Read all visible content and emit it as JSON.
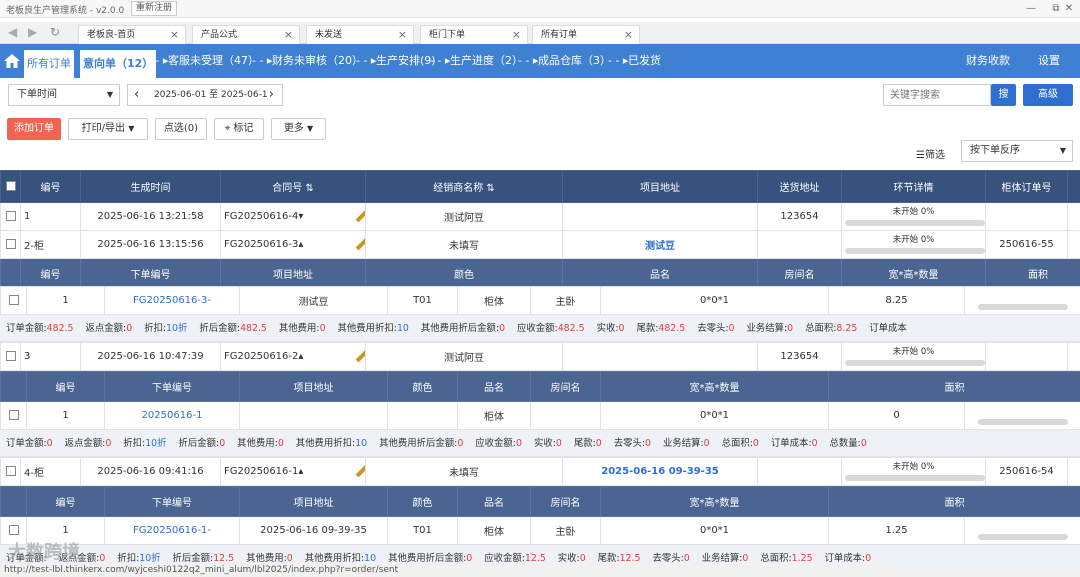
{
  "window": {
    "title": "老板良生产管理系统 - v2.0.0",
    "reregister": "重新注册",
    "min": "—",
    "restore": "⧉",
    "close": "✕"
  },
  "browser_tabs": [
    {
      "label": "老板良-首页"
    },
    {
      "label": "产品公式"
    },
    {
      "label": "未发送"
    },
    {
      "label": "柜门下单"
    },
    {
      "label": "所有订单"
    }
  ],
  "nav": {
    "home_icon": "home-icon",
    "all_orders": "所有订单",
    "intent": "意向单（12）",
    "s1": "客服未受理（47）",
    "s2": "财务未审核（20）",
    "s3": "生产安排(9)",
    "s4": "生产进度（2）",
    "s5": "成品仓库（3）",
    "s6": "已发货",
    "arrow": "- - ▸",
    "finance": "财务收款",
    "settings": "设置"
  },
  "filter": {
    "time_select": "下单时间",
    "date_range": "2025-06-01 至 2025-06-1",
    "prev": "‹",
    "next": "›",
    "search_placeholder": "关键字搜索",
    "search_btn": "搜",
    "advanced": "高级"
  },
  "toolbar": {
    "add": "添加订单",
    "print": "打印/导出",
    "select": "点选(0)",
    "mark": "标记",
    "more": "更多",
    "filter": "筛选",
    "sort": "按下单反序"
  },
  "columns": [
    "编号",
    "生成时间",
    "合同号",
    "经销商名称",
    "项目地址",
    "送货地址",
    "环节详情",
    "柜体订单号"
  ],
  "sub_columns": [
    "编号",
    "下单编号",
    "项目地址",
    "颜色",
    "品名",
    "房间名",
    "宽*高*数量",
    "面积"
  ],
  "progress_label": "未开始 0%",
  "orders": [
    {
      "no": "1",
      "time": "2025-06-16 13:21:58",
      "contract": "FG20250616-4",
      "caret": "▾",
      "dealer": "测试阿豆",
      "addr": "",
      "delivery": "123654",
      "cab": ""
    },
    {
      "no": "2-柜",
      "time": "2025-06-16 13:15:56",
      "contract": "FG20250616-3",
      "caret": "▴",
      "dealer": "未填写",
      "addr": "测试豆",
      "delivery": "",
      "cab": "250616-55",
      "sub": {
        "no": "1",
        "code": "FG20250616-3-",
        "addr": "测试豆",
        "color": "T01",
        "name": "柜体",
        "room": "主卧",
        "dims": "0*0*1",
        "area": "8.25"
      },
      "summary": [
        "订单金额:",
        "482.5",
        "返点金额:",
        "0",
        "折扣:",
        "10折",
        "折后金额:",
        "482.5",
        "其他费用:",
        "0",
        "其他费用折扣:",
        "10",
        "其他费用折后金额:",
        "0",
        "应收金额:",
        "482.5",
        "实收:",
        "0",
        "尾款:",
        "482.5",
        "去零头:",
        "0",
        "业务结算:",
        "0",
        "总面积:",
        "8.25",
        "订单成本",
        ""
      ]
    },
    {
      "no": "3",
      "time": "2025-06-16 10:47:39",
      "contract": "FG20250616-2",
      "caret": "▴",
      "dealer": "测试阿豆",
      "addr": "",
      "delivery": "123654",
      "cab": "",
      "sub": {
        "no": "1",
        "code": "20250616-1",
        "addr": "",
        "color": "",
        "name": "柜体",
        "room": "",
        "dims": "0*0*1",
        "area": "0"
      },
      "summary": [
        "订单金额:",
        "0",
        "返点金额:",
        "0",
        "折扣:",
        "10折",
        "折后金额:",
        "0",
        "其他费用:",
        "0",
        "其他费用折扣:",
        "10",
        "其他费用折后金额:",
        "0",
        "应收金额:",
        "0",
        "实收:",
        "0",
        "尾款:",
        "0",
        "去零头:",
        "0",
        "业务结算:",
        "0",
        "总面积:",
        "0",
        "订单成本:",
        "0",
        "总数量:",
        "0"
      ]
    },
    {
      "no": "4-柜",
      "time": "2025-06-16 09:41:16",
      "contract": "FG20250616-1",
      "caret": "▴",
      "dealer": "未填写",
      "addr": "2025-06-16 09-39-35",
      "delivery": "",
      "cab": "250616-54",
      "sub": {
        "no": "1",
        "code": "FG20250616-1-",
        "addr": "2025-06-16 09-39-35",
        "color": "T01",
        "name": "柜体",
        "room": "主卧",
        "dims": "0*0*1",
        "area": "1.25"
      },
      "summary": [
        "订单金额:",
        "",
        "返点金额:",
        "0",
        "折扣:",
        "10折",
        "折后金额:",
        "12.5",
        "其他费用:",
        "0",
        "其他费用折扣:",
        "10",
        "其他费用折后金额:",
        "0",
        "应收金额:",
        "12.5",
        "实收:",
        "0",
        "尾款:",
        "12.5",
        "去零头:",
        "0",
        "业务结算:",
        "0",
        "总面积:",
        "1.25",
        "订单成本:",
        "0"
      ]
    }
  ],
  "status_url": "http://test-lbl.thinkerx.com/wyjceshi0122q2_mini_alum/lbl2025/index.php?r=order/sent",
  "watermark": "大数跨境"
}
